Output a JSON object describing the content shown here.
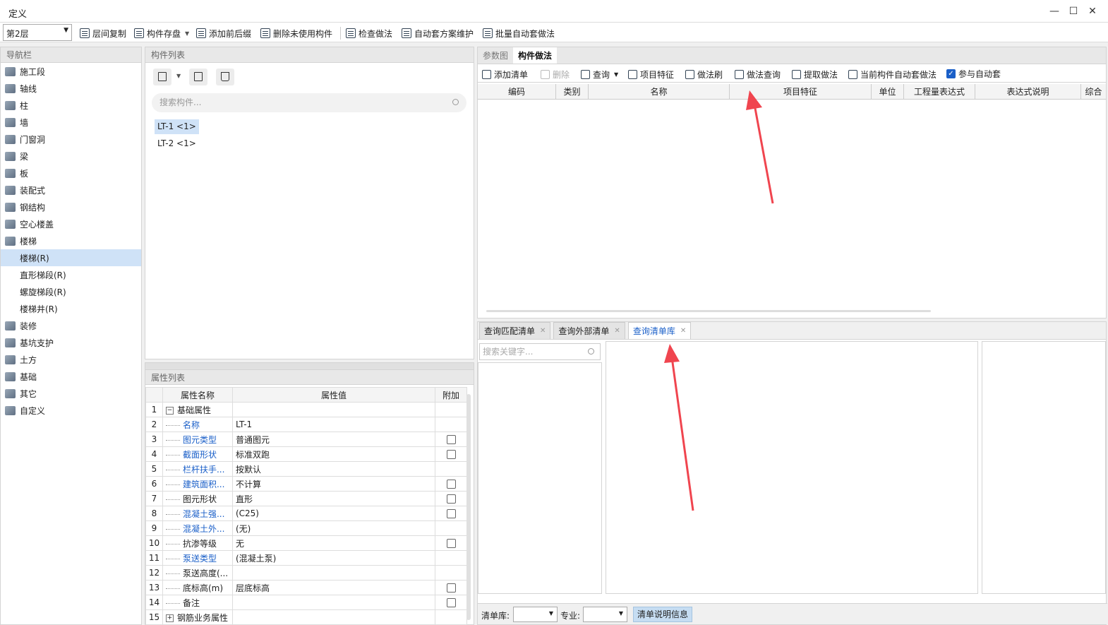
{
  "window": {
    "title": "定义",
    "minimize": "—",
    "maximize": "☐",
    "close": "✕"
  },
  "toolbar": {
    "floor": "第2层",
    "items": [
      "层间复制",
      "构件存盘",
      "添加前后缀",
      "删除未使用构件",
      "检查做法",
      "自动套方案维护",
      "批量自动套做法"
    ]
  },
  "nav": {
    "title": "导航栏",
    "items": [
      {
        "label": "施工段",
        "icon": "construction-section-icon"
      },
      {
        "label": "轴线",
        "icon": "axis-icon"
      },
      {
        "label": "柱",
        "icon": "column-icon"
      },
      {
        "label": "墙",
        "icon": "wall-icon"
      },
      {
        "label": "门窗洞",
        "icon": "door-window-icon"
      },
      {
        "label": "梁",
        "icon": "beam-icon"
      },
      {
        "label": "板",
        "icon": "slab-icon"
      },
      {
        "label": "装配式",
        "icon": "prefab-icon"
      },
      {
        "label": "钢结构",
        "icon": "steel-icon"
      },
      {
        "label": "空心楼盖",
        "icon": "hollow-floor-icon"
      },
      {
        "label": "楼梯",
        "icon": "stairs-icon"
      },
      {
        "label": "楼梯(R)",
        "sub": true,
        "selected": true
      },
      {
        "label": "直形梯段(R)",
        "sub": true
      },
      {
        "label": "螺旋梯段(R)",
        "sub": true
      },
      {
        "label": "楼梯井(R)",
        "sub": true
      },
      {
        "label": "装修",
        "icon": "decoration-icon"
      },
      {
        "label": "基坑支护",
        "icon": "pit-support-icon"
      },
      {
        "label": "土方",
        "icon": "earthwork-icon"
      },
      {
        "label": "基础",
        "icon": "foundation-icon"
      },
      {
        "label": "其它",
        "icon": "other-icon"
      },
      {
        "label": "自定义",
        "icon": "custom-icon"
      }
    ]
  },
  "components": {
    "title": "构件列表",
    "search_placeholder": "搜索构件...",
    "items": [
      "LT-1 <1>",
      "LT-2 <1>"
    ]
  },
  "properties": {
    "title": "属性列表",
    "headers": [
      "属性名称",
      "属性值",
      "附加"
    ],
    "rows": [
      {
        "n": "1",
        "name": "基础属性",
        "value": "",
        "blue": false,
        "group": "−",
        "check": false
      },
      {
        "n": "2",
        "name": "名称",
        "value": "LT-1",
        "blue": true,
        "check": false
      },
      {
        "n": "3",
        "name": "图元类型",
        "value": "普通图元",
        "blue": true,
        "check": true
      },
      {
        "n": "4",
        "name": "截面形状",
        "value": "标准双跑",
        "blue": true,
        "check": true
      },
      {
        "n": "5",
        "name": "栏杆扶手...",
        "value": "按默认",
        "blue": true,
        "check": false
      },
      {
        "n": "6",
        "name": "建筑面积...",
        "value": "不计算",
        "blue": true,
        "check": true
      },
      {
        "n": "7",
        "name": "图元形状",
        "value": "直形",
        "blue": false,
        "check": true
      },
      {
        "n": "8",
        "name": "混凝土强...",
        "value": "(C25)",
        "blue": true,
        "check": true
      },
      {
        "n": "9",
        "name": "混凝土外...",
        "value": "(无)",
        "blue": true,
        "check": false
      },
      {
        "n": "10",
        "name": "抗渗等级",
        "value": "无",
        "blue": false,
        "check": true
      },
      {
        "n": "11",
        "name": "泵送类型",
        "value": "(混凝土泵)",
        "blue": true,
        "check": false
      },
      {
        "n": "12",
        "name": "泵送高度(...",
        "value": "",
        "blue": false,
        "check": false
      },
      {
        "n": "13",
        "name": "底标高(m)",
        "value": "层底标高",
        "blue": false,
        "check": true
      },
      {
        "n": "14",
        "name": "备注",
        "value": "",
        "blue": false,
        "check": true
      },
      {
        "n": "15",
        "name": "钢筋业务属性",
        "value": "",
        "blue": false,
        "group": "+",
        "check": false
      }
    ]
  },
  "methods": {
    "tabs": [
      "参数图",
      "构件做法"
    ],
    "tools": [
      "添加清单",
      "删除",
      "查询",
      "项目特征",
      "做法刷",
      "做法查询",
      "提取做法",
      "当前构件自动套做法",
      "参与自动套"
    ],
    "columns": [
      "编码",
      "类别",
      "名称",
      "项目特征",
      "单位",
      "工程量表达式",
      "表达式说明",
      "综合"
    ]
  },
  "query": {
    "tabs": [
      "查询匹配清单",
      "查询外部清单",
      "查询清单库"
    ],
    "search_placeholder": "搜索关键字...",
    "lib_label": "清单库:",
    "major_label": "专业:",
    "info_button": "清单说明信息"
  },
  "colors": {
    "accent": "#1a5fc8",
    "selected": "#cfe2f7",
    "annotation_arrow": "#f0454f"
  }
}
